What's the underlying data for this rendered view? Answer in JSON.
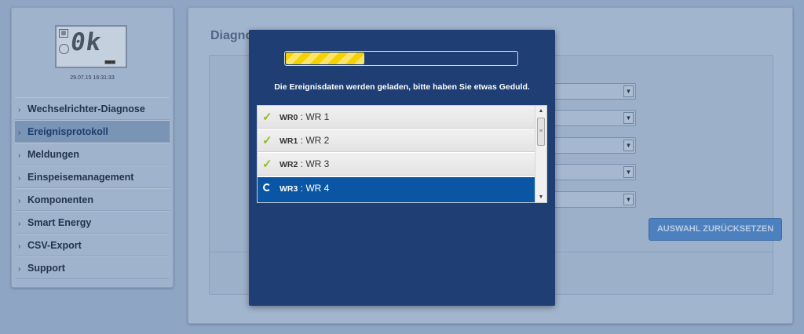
{
  "sidebar": {
    "lcd_text": "0k",
    "lcd_dots": "■■■",
    "timestamp": "29.07.15 16:31:33",
    "items": [
      {
        "label": "Wechselrichter-Diagnose",
        "active": false
      },
      {
        "label": "Ereignisprotokoll",
        "active": true
      },
      {
        "label": "Meldungen",
        "active": false
      },
      {
        "label": "Einspeisemanagement",
        "active": false
      },
      {
        "label": "Komponenten",
        "active": false
      },
      {
        "label": "Smart Energy",
        "active": false
      },
      {
        "label": "CSV-Export",
        "active": false
      },
      {
        "label": "Support",
        "active": false
      }
    ]
  },
  "main": {
    "title": "Diagnose",
    "reset_button": "AUSWAHL ZURÜCKSETZEN",
    "select_count": 5
  },
  "modal": {
    "progress_fraction": 0.34,
    "message": "Die Ereignisdaten werden geladen, bitte haben Sie etwas Geduld.",
    "rows": [
      {
        "id": "WR0",
        "name": "WR 1",
        "status": "done"
      },
      {
        "id": "WR1",
        "name": "WR 2",
        "status": "done"
      },
      {
        "id": "WR2",
        "name": "WR 3",
        "status": "done"
      },
      {
        "id": "WR3",
        "name": "WR 4",
        "status": "loading"
      }
    ]
  },
  "colors": {
    "modal_bg": "#1e3e74",
    "progress_fill": "#f5d100",
    "active_row": "#0a56a4",
    "check": "#8cc21f"
  }
}
